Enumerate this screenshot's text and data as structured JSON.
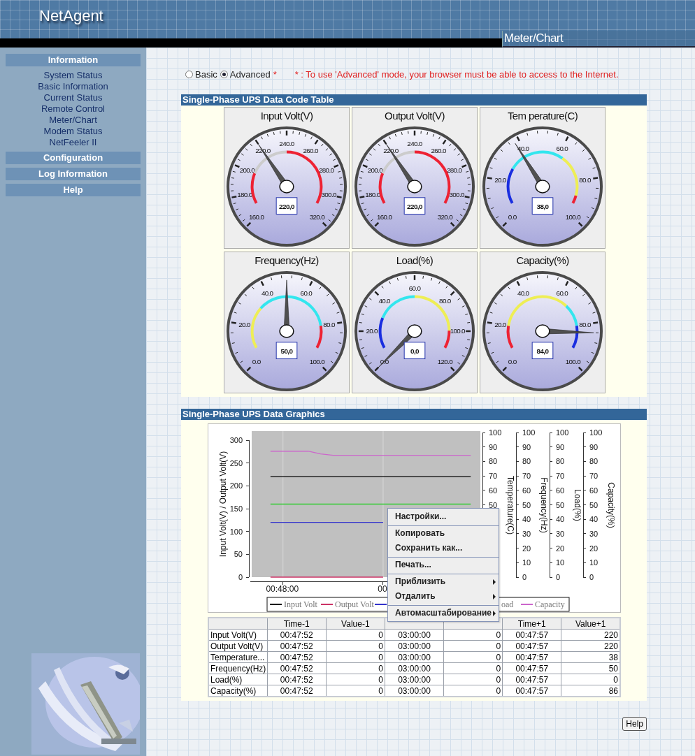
{
  "header": {
    "logo": "NetAgent",
    "page_title": "Meter/Chart"
  },
  "sidebar": {
    "sections": [
      {
        "title": "Information",
        "items": [
          "System Status",
          "Basic Information",
          "Current Status",
          "Remote Control",
          "Meter/Chart",
          "Modem Status",
          "NetFeeler II"
        ]
      },
      {
        "title": "Configuration"
      },
      {
        "title": "Log Information"
      },
      {
        "title": "Help"
      }
    ]
  },
  "mode": {
    "options": [
      {
        "label": "Basic",
        "selected": false
      },
      {
        "label": "Advanced",
        "selected": true,
        "required_mark": "*"
      }
    ],
    "note": "* : To use 'Advanced' mode, your browser must be able to access to the Internet."
  },
  "code_table": {
    "title": "Single-Phase UPS Data Code Table",
    "gauges": [
      {
        "title": "Input Volt(V)",
        "labels": [
          "160.0",
          "180.0",
          "200.0",
          "220.0",
          "240.0",
          "260.0",
          "280.0",
          "300.0",
          "320.0"
        ],
        "value": "220,0",
        "bands": [
          {
            "color": "#ee2233"
          },
          {
            "color": "#cccccc"
          },
          {
            "color": "#ee2233"
          }
        ]
      },
      {
        "title": "Output Volt(V)",
        "labels": [
          "160.0",
          "180.0",
          "200.0",
          "220.0",
          "240.0",
          "260.0",
          "280.0",
          "300.0",
          "320.0"
        ],
        "value": "220,0",
        "bands": [
          {
            "color": "#ee2233"
          },
          {
            "color": "#cccccc"
          },
          {
            "color": "#ee2233"
          }
        ]
      },
      {
        "title": "Tem perature(C)",
        "labels": [
          "0.0",
          "20.0",
          "40.0",
          "60.0",
          "80.0",
          "100.0"
        ],
        "value": "38,0",
        "bands": [
          {
            "color": "#1a2ee0"
          },
          {
            "color": "#33e6ee"
          },
          {
            "color": "#eeee55"
          },
          {
            "color": "#ee2233"
          }
        ]
      },
      {
        "title": "Frequency(Hz)",
        "labels": [
          "0.0",
          "20.0",
          "40.0",
          "60.0",
          "80.0",
          "100.0"
        ],
        "value": "50,0",
        "bands": [
          {
            "color": "#eeee55"
          },
          {
            "color": "#33e6ee"
          },
          {
            "color": "#ee2233"
          }
        ]
      },
      {
        "title": "Load(%)",
        "labels": [
          "0.0",
          "20.0",
          "40.0",
          "60.0",
          "80.0",
          "100.0",
          "120.0"
        ],
        "value": "0,0",
        "bands": [
          {
            "color": "#1a2ee0"
          },
          {
            "color": "#33e6ee"
          },
          {
            "color": "#eeee55"
          },
          {
            "color": "#ee2233"
          }
        ]
      },
      {
        "title": "Capacity(%)",
        "labels": [
          "0.0",
          "20.0",
          "40.0",
          "60.0",
          "80.0",
          "100.0"
        ],
        "value": "84,0",
        "bands": [
          {
            "color": "#ee2233"
          },
          {
            "color": "#eeee55"
          },
          {
            "color": "#33e6ee"
          },
          {
            "color": "#1a2ee0"
          }
        ]
      }
    ]
  },
  "graphics": {
    "title": "Single-Phase UPS Data Graphics",
    "chart_data": {
      "type": "line",
      "ylabel": "Input Volt(V) / Output Volt(V)",
      "categories": [
        null,
        "00:48:00",
        null,
        null,
        null,
        null,
        null,
        null,
        null,
        "00",
        null,
        null,
        null,
        null,
        null,
        null,
        null,
        null
      ],
      "ylim": [
        0,
        320
      ],
      "yticks": [
        0,
        50,
        100,
        150,
        200,
        250,
        300
      ],
      "series": [
        {
          "color": "#000000",
          "values": [
            220,
            220,
            220,
            220,
            220,
            220,
            220,
            220,
            220,
            220,
            220,
            220,
            220,
            220,
            220,
            220,
            220,
            null
          ]
        },
        {
          "color": "#cc3366",
          "values": [
            0,
            0,
            0,
            0,
            0,
            0,
            0,
            0,
            0,
            0,
            null,
            null,
            null,
            null,
            null,
            null,
            null,
            null
          ]
        },
        {
          "color": "#3333cc",
          "values": [
            120,
            120,
            120,
            120,
            120,
            120,
            120,
            120,
            120,
            120,
            null,
            null,
            null,
            null,
            null,
            null,
            null,
            null
          ]
        },
        {
          "color": "#33cc33",
          "values": [
            160,
            160,
            160,
            160,
            160,
            160,
            160,
            160,
            160,
            160,
            160,
            160,
            160,
            160,
            160,
            160,
            160,
            null
          ]
        },
        {
          "color": "#cc66cc",
          "values": [
            276,
            276,
            276,
            276,
            270,
            267,
            267,
            267,
            267,
            267,
            267,
            267,
            267,
            267,
            267,
            267,
            267,
            null
          ]
        }
      ]
    },
    "right_axes": [
      {
        "label": "Temperature(C)",
        "ticks": [
          "100",
          "90",
          "80",
          "70",
          "60",
          "50"
        ]
      },
      {
        "label": "Frequency(Hz)",
        "ticks": [
          "100",
          "90",
          "80",
          "70",
          "60",
          "50",
          "40",
          "30",
          "20",
          "10",
          "0"
        ]
      },
      {
        "label": "Load(%)",
        "ticks": [
          "100",
          "90",
          "80",
          "70",
          "60",
          "50",
          "40",
          "30",
          "20",
          "10",
          "0"
        ]
      },
      {
        "label": "Capacity(%)",
        "ticks": [
          "100",
          "90",
          "80",
          "70",
          "60",
          "50",
          "40",
          "30",
          "20",
          "10",
          "0"
        ]
      }
    ],
    "legend": [
      {
        "label": "Input Volt",
        "color": "#000000"
      },
      {
        "label": "Output Volt",
        "color": "#cc3366"
      },
      {
        "color": "#3333cc"
      },
      {
        "label": "oad"
      },
      {
        "label": "Capacity",
        "color": "#cc66cc"
      }
    ],
    "table": {
      "columns": [
        "",
        "Time-1",
        "Value-1",
        "",
        "",
        "Time+1",
        "Value+1"
      ],
      "rows": [
        [
          "Input Volt(V)",
          "00:47:52",
          "0",
          "03:00:00",
          "0",
          "00:47:57",
          "220"
        ],
        [
          "Output Volt(V)",
          "00:47:52",
          "0",
          "03:00:00",
          "0",
          "00:47:57",
          "220"
        ],
        [
          "Temperature...",
          "00:47:52",
          "0",
          "03:00:00",
          "0",
          "00:47:57",
          "38"
        ],
        [
          "Frequency(Hz)",
          "00:47:52",
          "0",
          "03:00:00",
          "0",
          "00:47:57",
          "50"
        ],
        [
          "Load(%)",
          "00:47:52",
          "0",
          "03:00:00",
          "0",
          "00:47:57",
          "0"
        ],
        [
          "Capacity(%)",
          "00:47:52",
          "0",
          "03:00:00",
          "0",
          "00:47:57",
          "86"
        ]
      ]
    },
    "context_menu": [
      {
        "label": "Настройки...",
        "separator_before": false,
        "submenu": false
      },
      {
        "label": "Копировать",
        "separator_before": true,
        "submenu": false
      },
      {
        "label": "Сохранить как...",
        "separator_before": false,
        "submenu": false
      },
      {
        "label": "Печать...",
        "separator_before": true,
        "submenu": false
      },
      {
        "label": "Приблизить",
        "separator_before": true,
        "submenu": true
      },
      {
        "label": "Отдалить",
        "separator_before": false,
        "submenu": true
      },
      {
        "label": "Автомасштабирование",
        "separator_before": true,
        "submenu": true
      }
    ]
  },
  "help_button": "Help"
}
